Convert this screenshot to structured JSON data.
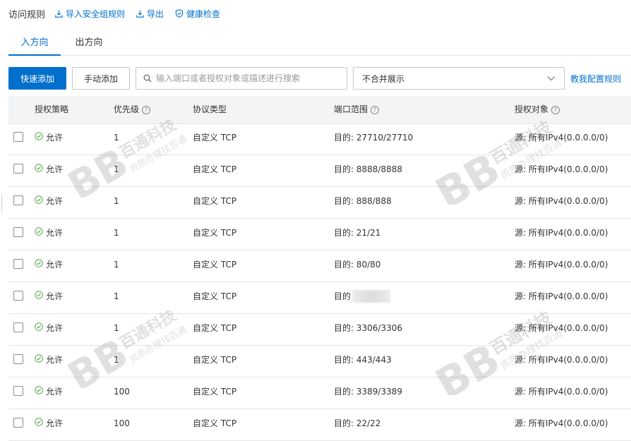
{
  "header": {
    "title": "访问规则",
    "links": [
      {
        "label": "导入安全组规则",
        "icon": "import-icon"
      },
      {
        "label": "导出",
        "icon": "export-icon"
      },
      {
        "label": "健康检查",
        "icon": "shield-check-icon"
      }
    ]
  },
  "tabs": [
    {
      "label": "入方向",
      "active": true
    },
    {
      "label": "出方向",
      "active": false
    }
  ],
  "toolbar": {
    "quick_add": "快速添加",
    "manual_add": "手动添加",
    "search_placeholder": "输入端口或者授权对象或描述进行搜索",
    "select_value": "不合并展示",
    "guide_link": "教我配置规则"
  },
  "table": {
    "columns": [
      "授权策略",
      "优先级",
      "协议类型",
      "端口范围",
      "授权对象"
    ],
    "rows": [
      {
        "policy": "允许",
        "priority": "1",
        "protocol": "自定义 TCP",
        "port": "目的: 27710/27710",
        "source": "源: 所有IPv4(0.0.0.0/0)"
      },
      {
        "policy": "允许",
        "priority": "1",
        "protocol": "自定义 TCP",
        "port": "目的: 8888/8888",
        "source": "源: 所有IPv4(0.0.0.0/0)"
      },
      {
        "policy": "允许",
        "priority": "1",
        "protocol": "自定义 TCP",
        "port": "目的: 888/888",
        "source": "源: 所有IPv4(0.0.0.0/0)"
      },
      {
        "policy": "允许",
        "priority": "1",
        "protocol": "自定义 TCP",
        "port": "目的: 21/21",
        "source": "源: 所有IPv4(0.0.0.0/0)"
      },
      {
        "policy": "允许",
        "priority": "1",
        "protocol": "自定义 TCP",
        "port": "目的: 80/80",
        "source": "源: 所有IPv4(0.0.0.0/0)"
      },
      {
        "policy": "允许",
        "priority": "1",
        "protocol": "自定义 TCP",
        "port": "目的",
        "source": "源: 所有IPv4(0.0.0.0/0)"
      },
      {
        "policy": "允许",
        "priority": "1",
        "protocol": "自定义 TCP",
        "port": "目的: 3306/3306",
        "source": "源: 所有IPv4(0.0.0.0/0)"
      },
      {
        "policy": "允许",
        "priority": "1",
        "protocol": "自定义 TCP",
        "port": "目的: 443/443",
        "source": "源: 所有IPv4(0.0.0.0/0)"
      },
      {
        "policy": "允许",
        "priority": "100",
        "protocol": "自定义 TCP",
        "port": "目的: 3389/3389",
        "source": "源: 所有IPv4(0.0.0.0/0)"
      },
      {
        "policy": "允许",
        "priority": "100",
        "protocol": "自定义 TCP",
        "port": "目的: 22/22",
        "source": "源: 所有IPv4(0.0.0.0/0)"
      }
    ]
  },
  "watermark": {
    "brand": "百通科技",
    "tagline": "资质办理找百通"
  },
  "colors": {
    "accent": "#0070cc",
    "allow_green": "#52a848",
    "header_bg": "#f3f4f6"
  }
}
